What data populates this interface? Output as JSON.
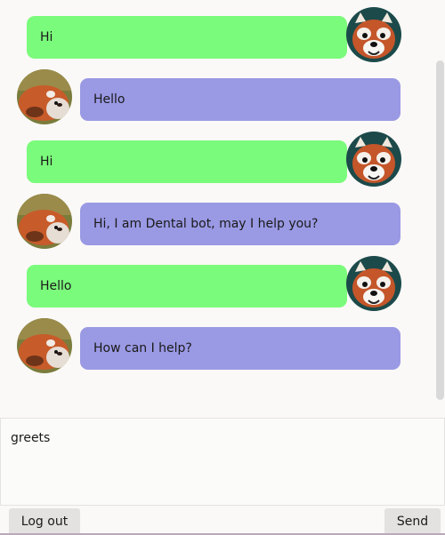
{
  "colors": {
    "user_bubble": "#7bfb7b",
    "bot_bubble": "#9a99e4"
  },
  "messages": [
    {
      "sender": "user",
      "text": "Hi"
    },
    {
      "sender": "bot",
      "text": "Hello"
    },
    {
      "sender": "user",
      "text": "Hi"
    },
    {
      "sender": "bot",
      "text": "Hi, I am Dental bot, may I help you?"
    },
    {
      "sender": "user",
      "text": "Hello"
    },
    {
      "sender": "bot",
      "text": "How can I help?"
    }
  ],
  "avatars": {
    "user": "red-panda-face-icon",
    "bot": "red-panda-lying-icon"
  },
  "composer": {
    "value": "greets"
  },
  "buttons": {
    "logout": "Log out",
    "send": "Send"
  }
}
